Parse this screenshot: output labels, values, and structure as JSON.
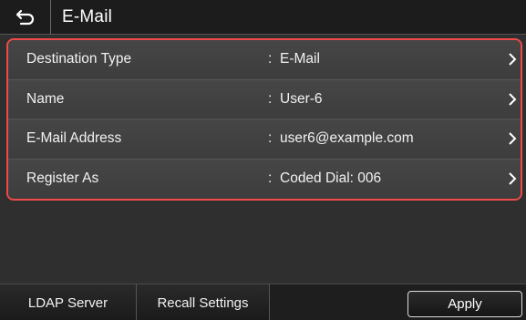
{
  "header": {
    "title": "E-Mail",
    "back_icon": "back-arrow-icon"
  },
  "settings": [
    {
      "label": "Destination Type",
      "separator": ":",
      "value": "E-Mail"
    },
    {
      "label": "Name",
      "separator": ":",
      "value": "User-6"
    },
    {
      "label": "E-Mail Address",
      "separator": ":",
      "value": "user6@example.com"
    },
    {
      "label": "Register As",
      "separator": ":",
      "value": "Coded Dial: 006"
    }
  ],
  "toolbar": {
    "ldap_label": "LDAP Server",
    "recall_label": "Recall Settings",
    "apply_label": "Apply"
  },
  "colors": {
    "highlight_border": "#ef4a4a",
    "background": "#2f2f2f"
  }
}
